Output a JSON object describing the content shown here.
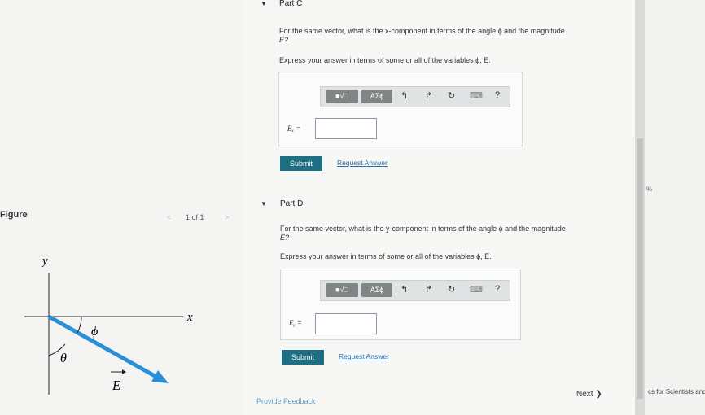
{
  "figure": {
    "heading": "Figure",
    "pager": "1 of 1",
    "prev_icon": "chevron-left-icon",
    "next_icon": "chevron-right-icon",
    "labels": {
      "y": "y",
      "x": "x",
      "phi": "ϕ",
      "theta": "θ",
      "E": "E"
    }
  },
  "partC": {
    "title": "Part C",
    "question_line1": "For the same vector, what is the x-component in terms of the angle ϕ and the magnitude",
    "question_line2": "E?",
    "instruction": "Express your answer in terms of some or all of the variables ϕ, E.",
    "var_label": "Eₓ =",
    "input_value": "",
    "submit": "Submit",
    "request": "Request Answer"
  },
  "partD": {
    "title": "Part D",
    "question_line1": "For the same vector, what is the y-component in terms of the angle ϕ and the magnitude",
    "question_line2": "E?",
    "instruction": "Express your answer in terms of some or all of the variables ϕ, E.",
    "var_label": "Eᵧ =",
    "input_value": "",
    "submit": "Submit",
    "request": "Request Answer"
  },
  "toolbar": {
    "template_btn": "■√□",
    "greek_btn": "AΣϕ",
    "undo": "↰",
    "redo": "↱",
    "reset": "↻",
    "keyboard": "⌨",
    "help": "?"
  },
  "footer": {
    "feedback": "Provide Feedback",
    "next": "Next ❯"
  },
  "right_strip": {
    "percent": "%",
    "book": "cs for Scientists and"
  }
}
